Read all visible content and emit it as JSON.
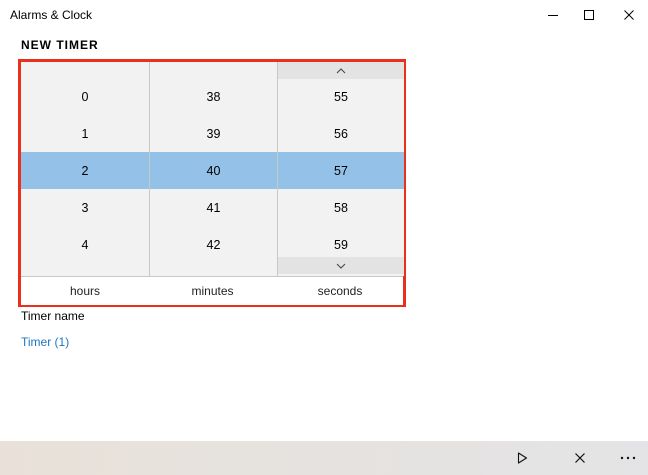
{
  "window": {
    "title": "Alarms & Clock",
    "controls": {
      "minimize": "minimize-icon",
      "maximize": "maximize-icon",
      "close": "close-icon"
    }
  },
  "page": {
    "heading": "NEW TIMER"
  },
  "picker": {
    "hours": [
      "0",
      "1",
      "2",
      "3",
      "4"
    ],
    "minutes": [
      "38",
      "39",
      "40",
      "41",
      "42"
    ],
    "seconds": [
      "55",
      "56",
      "57",
      "58",
      "59"
    ],
    "selected": {
      "hours": "2",
      "minutes": "40",
      "seconds": "57"
    },
    "labels": {
      "hours": "hours",
      "minutes": "minutes",
      "seconds": "seconds"
    },
    "colors": {
      "highlight_border": "#e8301c",
      "selected_row": "#93c1e7",
      "column_bg": "#f2f2f2"
    }
  },
  "timer_name": {
    "label": "Timer name",
    "value": "Timer (1)",
    "value_color": "#1a78c2"
  },
  "command_bar": {
    "icons": [
      "play-icon",
      "close-icon",
      "more-icon"
    ]
  }
}
